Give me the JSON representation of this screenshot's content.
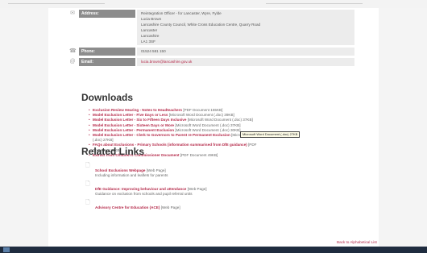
{
  "contact": {
    "address_label": "Address:",
    "address_lines": [
      "Reintegration Officer - for Lancaster, Wyre, Fylde",
      "Lucia Brown",
      "Lancashire County Council, White Cross Education Centre, Quarry Road",
      "Lancaster",
      "Lancashire",
      "LA1 3SF"
    ],
    "phone_label": "Phone:",
    "phone_value": "01524 581 150",
    "email_label": "Email:",
    "email_value": "lucia.brown@lancashire.gov.uk"
  },
  "downloads": {
    "title": "Downloads",
    "items": [
      {
        "link": "Exclusion Review Hearing - Notes to Headteachers",
        "meta": "[PDF Document 155KB]"
      },
      {
        "link": "Model Exclusion Letter - Five Days or Less",
        "meta": "[Microsoft Word Document (.doc) 39KB]"
      },
      {
        "link": "Model Exclusion Letter - Six to Fifteen Days Inclusive",
        "meta": "[Microsoft Word Document (.doc) 37KB]"
      },
      {
        "link": "Model Exclusion Letter - Sixteen Days or More",
        "meta": "[Microsoft Word Document (.doc) 37KB]"
      },
      {
        "link": "Model Exclusion Letter - Permanent Exclusion",
        "meta": "[Microsoft Word Document (.doc) 30KB]"
      },
      {
        "link": "Model Exclusion Letter - Clerk to Governors to Parent re Permanent Exclusion",
        "meta": "[Microsoft Word Document",
        "cont": "(.doc) 27KB]"
      },
      {
        "link": "FAQs about Exclusions - Primary Schools (information summarised from DfE guidance)",
        "meta": "[PDF",
        "cont": "Document 39KB]"
      },
      {
        "link": "Extract from Children's Commissioner Document",
        "meta": "[PDF Document 49KB]"
      }
    ],
    "tooltip": "Microsoft Word Document (.doc) 27KB"
  },
  "related": {
    "title": "Related Links",
    "items": [
      {
        "link": "School Exclusions Webpage",
        "meta": "[Web Page]",
        "desc": "Including information and leaflets for parents"
      },
      {
        "link": "DfE Guidance: Improving behaviour and attendance",
        "meta": "[Web Page]",
        "desc": "Guidance on exclusion from schools and pupil referral units"
      },
      {
        "link": "Advisory Centre for Education (ACE)",
        "meta": "[Web Page]",
        "desc": ""
      }
    ]
  },
  "back_link": "Back to Alphabetical List"
}
